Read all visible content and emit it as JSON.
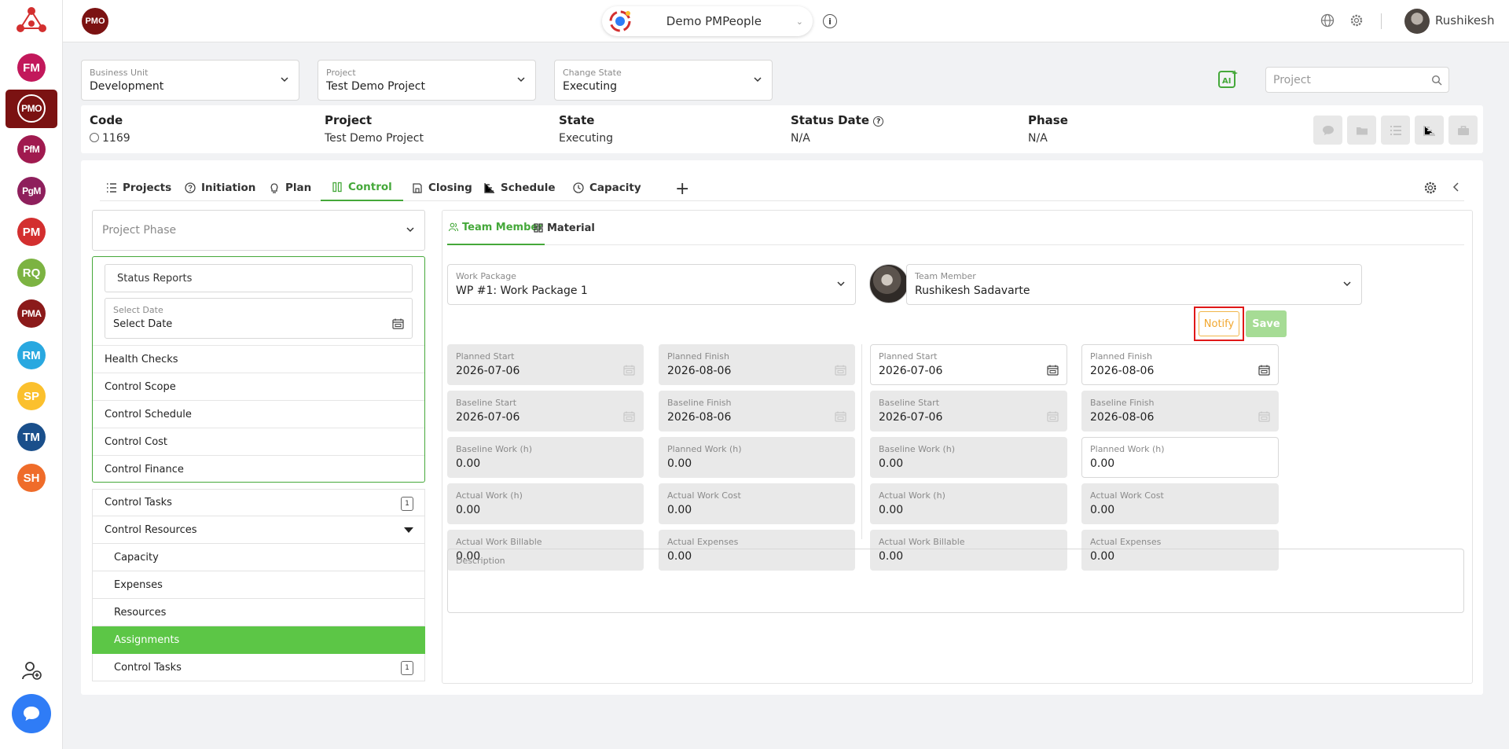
{
  "rail": {
    "apps": [
      {
        "label": "FM",
        "color": "#c2185b"
      },
      {
        "label": "PMO",
        "color": "#7b1212"
      },
      {
        "label": "PfM",
        "color": "#a01a4f"
      },
      {
        "label": "PgM",
        "color": "#8e1f5c"
      },
      {
        "label": "PM",
        "color": "#d32f2f"
      },
      {
        "label": "RQ",
        "color": "#7cb342"
      },
      {
        "label": "PMA",
        "color": "#8b1a1a"
      },
      {
        "label": "RM",
        "color": "#29a8e0"
      },
      {
        "label": "SP",
        "color": "#fbc02d"
      },
      {
        "label": "TM",
        "color": "#1a4f8b"
      },
      {
        "label": "SH",
        "color": "#ef6c2a"
      }
    ]
  },
  "topbar": {
    "badge": "PMO",
    "workspace": "Demo PMPeople",
    "info": "i",
    "user": "Rushikesh"
  },
  "filters": {
    "business_unit": {
      "label": "Business Unit",
      "value": "Development"
    },
    "project": {
      "label": "Project",
      "value": "Test Demo Project"
    },
    "change_state": {
      "label": "Change State",
      "value": "Executing"
    },
    "search_placeholder": "Project"
  },
  "info": {
    "code_h": "Code",
    "code_v": "1169",
    "project_h": "Project",
    "project_v": "Test Demo Project",
    "state_h": "State",
    "state_v": "Executing",
    "status_h": "Status Date",
    "status_v": "N/A",
    "phase_h": "Phase",
    "phase_v": "N/A"
  },
  "tabs": [
    "Projects",
    "Initiation",
    "Plan",
    "Control",
    "Closing",
    "Schedule",
    "Capacity"
  ],
  "left": {
    "phase_placeholder": "Project Phase",
    "status_reports": "Status Reports",
    "select_date_label": "Select Date",
    "select_date_value": "Select Date",
    "menu": [
      "Health Checks",
      "Control Scope",
      "Control Schedule",
      "Control Cost",
      "Control Finance"
    ],
    "control_tasks": "Control Tasks",
    "control_tasks_count": "1",
    "control_resources": "Control Resources",
    "resources_sub": [
      "Capacity",
      "Expenses",
      "Resources",
      "Assignments"
    ],
    "sub_control_tasks": "Control Tasks",
    "sub_control_tasks_count": "1"
  },
  "right": {
    "subtabs": [
      "Team Member",
      "Material"
    ],
    "work_package": {
      "label": "Work Package",
      "value": "WP #1: Work Package 1"
    },
    "team_member": {
      "label": "Team Member",
      "value": "Rushikesh Sadavarte"
    },
    "notify": "Notify",
    "save": "Save",
    "left_fields": [
      {
        "label": "Planned Start",
        "value": "2026-07-06"
      },
      {
        "label": "Planned Finish",
        "value": "2026-08-06"
      },
      {
        "label": "Baseline Start",
        "value": "2026-07-06"
      },
      {
        "label": "Baseline Finish",
        "value": "2026-08-06"
      },
      {
        "label": "Baseline Work (h)",
        "value": "0.00"
      },
      {
        "label": "Planned Work (h)",
        "value": "0.00"
      },
      {
        "label": "Actual Work (h)",
        "value": "0.00"
      },
      {
        "label": "Actual Work Cost",
        "value": "0.00"
      },
      {
        "label": "Actual Work Billable",
        "value": "0.00"
      },
      {
        "label": "Actual Expenses",
        "value": "0.00"
      }
    ],
    "right_fields": [
      {
        "label": "Planned Start",
        "value": "2026-07-06"
      },
      {
        "label": "Planned Finish",
        "value": "2026-08-06"
      },
      {
        "label": "Baseline Start",
        "value": "2026-07-06"
      },
      {
        "label": "Baseline Finish",
        "value": "2026-08-06"
      },
      {
        "label": "Baseline Work (h)",
        "value": "0.00"
      },
      {
        "label": "Planned Work (h)",
        "value": "0.00"
      },
      {
        "label": "Actual Work (h)",
        "value": "0.00"
      },
      {
        "label": "Actual Work Cost",
        "value": "0.00"
      },
      {
        "label": "Actual Work Billable",
        "value": "0.00"
      },
      {
        "label": "Actual Expenses",
        "value": "0.00"
      }
    ],
    "description_label": "Description"
  }
}
